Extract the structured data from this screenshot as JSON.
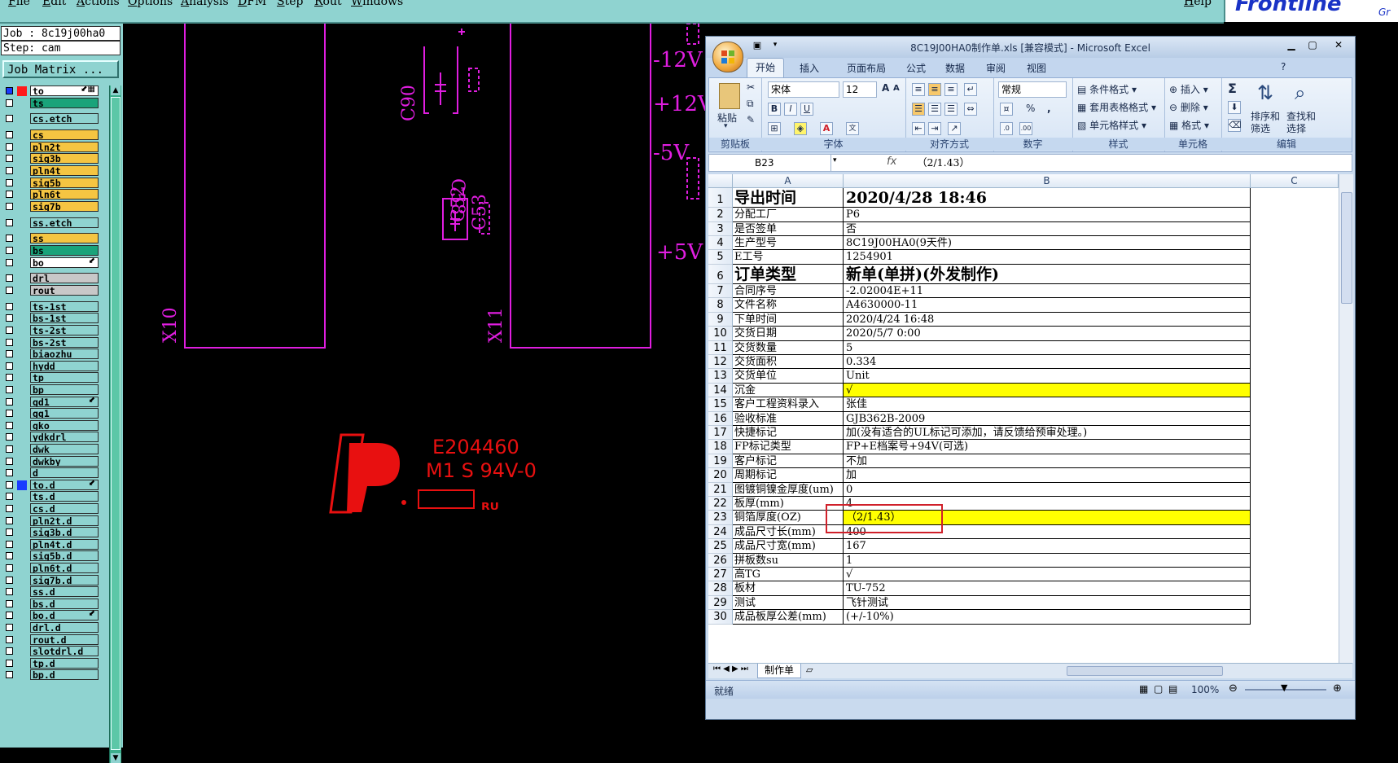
{
  "menu": [
    "File",
    "Edit",
    "Actions",
    "Options",
    "Analysis",
    "DFM",
    "Step",
    "Rout",
    "Windows"
  ],
  "help": "Help",
  "logo": {
    "brand": "Frontline",
    "suffix": "Gr"
  },
  "job": {
    "job_line": "Job : 8c19j00ha0",
    "step_line": "Step: cam",
    "matrix_button": "Job Matrix ..."
  },
  "layers": [
    {
      "name": "to",
      "color": "#ffffff",
      "swatch": "#ff1a1a",
      "mark": "⬋▦"
    },
    {
      "name": "ts",
      "color": "#1aa37a",
      "swatch": "",
      "mark": ""
    },
    {
      "name": "cs.etch",
      "color": "#8fd3d0",
      "swatch": "",
      "mark": ""
    },
    {
      "name": "cs",
      "color": "#f5c542",
      "swatch": "",
      "mark": ""
    },
    {
      "name": "pln2t",
      "color": "#f5c542",
      "swatch": "",
      "mark": ""
    },
    {
      "name": "sig3b",
      "color": "#f5c542",
      "swatch": "",
      "mark": ""
    },
    {
      "name": "pln4t",
      "color": "#f5c542",
      "swatch": "",
      "mark": ""
    },
    {
      "name": "sig5b",
      "color": "#f5c542",
      "swatch": "",
      "mark": ""
    },
    {
      "name": "pln6t",
      "color": "#f5c542",
      "swatch": "",
      "mark": ""
    },
    {
      "name": "sig7b",
      "color": "#f5c542",
      "swatch": "",
      "mark": ""
    },
    {
      "name": "ss.etch",
      "color": "#8fd3d0",
      "swatch": "",
      "mark": ""
    },
    {
      "name": "ss",
      "color": "#f5c542",
      "swatch": "",
      "mark": ""
    },
    {
      "name": "bs",
      "color": "#1aa37a",
      "swatch": "",
      "mark": ""
    },
    {
      "name": "bo",
      "color": "#ffffff",
      "swatch": "",
      "mark": "⬋"
    },
    {
      "name": "drl",
      "color": "#c8c8c8",
      "swatch": "",
      "mark": ""
    },
    {
      "name": "rout",
      "color": "#c8c8c8",
      "swatch": "",
      "mark": ""
    },
    {
      "name": "ts-1st",
      "color": "#8fd3d0",
      "swatch": "",
      "mark": ""
    },
    {
      "name": "bs-1st",
      "color": "#8fd3d0",
      "swatch": "",
      "mark": ""
    },
    {
      "name": "ts-2st",
      "color": "#8fd3d0",
      "swatch": "",
      "mark": ""
    },
    {
      "name": "bs-2st",
      "color": "#8fd3d0",
      "swatch": "",
      "mark": ""
    },
    {
      "name": "biaozhu",
      "color": "#8fd3d0",
      "swatch": "",
      "mark": ""
    },
    {
      "name": "hydd",
      "color": "#8fd3d0",
      "swatch": "",
      "mark": ""
    },
    {
      "name": "tp",
      "color": "#8fd3d0",
      "swatch": "",
      "mark": ""
    },
    {
      "name": "bp",
      "color": "#8fd3d0",
      "swatch": "",
      "mark": ""
    },
    {
      "name": "gd1",
      "color": "#8fd3d0",
      "swatch": "",
      "mark": "⬋"
    },
    {
      "name": "gg1",
      "color": "#8fd3d0",
      "swatch": "",
      "mark": ""
    },
    {
      "name": "gko",
      "color": "#8fd3d0",
      "swatch": "",
      "mark": ""
    },
    {
      "name": "ydkdrl",
      "color": "#8fd3d0",
      "swatch": "",
      "mark": ""
    },
    {
      "name": "dwk",
      "color": "#8fd3d0",
      "swatch": "",
      "mark": ""
    },
    {
      "name": "dwkby",
      "color": "#8fd3d0",
      "swatch": "",
      "mark": ""
    },
    {
      "name": "d",
      "color": "#8fd3d0",
      "swatch": "",
      "mark": ""
    },
    {
      "name": "to.d",
      "color": "#8fd3d0",
      "swatch": "#1a3cff",
      "mark": "⬋"
    },
    {
      "name": "ts.d",
      "color": "#8fd3d0",
      "swatch": "",
      "mark": ""
    },
    {
      "name": "cs.d",
      "color": "#8fd3d0",
      "swatch": "",
      "mark": ""
    },
    {
      "name": "pln2t.d",
      "color": "#8fd3d0",
      "swatch": "",
      "mark": ""
    },
    {
      "name": "sig3b.d",
      "color": "#8fd3d0",
      "swatch": "",
      "mark": ""
    },
    {
      "name": "pln4t.d",
      "color": "#8fd3d0",
      "swatch": "",
      "mark": ""
    },
    {
      "name": "sig5b.d",
      "color": "#8fd3d0",
      "swatch": "",
      "mark": ""
    },
    {
      "name": "pln6t.d",
      "color": "#8fd3d0",
      "swatch": "",
      "mark": ""
    },
    {
      "name": "sig7b.d",
      "color": "#8fd3d0",
      "swatch": "",
      "mark": ""
    },
    {
      "name": "ss.d",
      "color": "#8fd3d0",
      "swatch": "",
      "mark": ""
    },
    {
      "name": "bs.d",
      "color": "#8fd3d0",
      "swatch": "",
      "mark": ""
    },
    {
      "name": "bo.d",
      "color": "#8fd3d0",
      "swatch": "",
      "mark": "⬋"
    },
    {
      "name": "drl.d",
      "color": "#8fd3d0",
      "swatch": "",
      "mark": ""
    },
    {
      "name": "rout.d",
      "color": "#8fd3d0",
      "swatch": "",
      "mark": ""
    },
    {
      "name": "slotdrl.d",
      "color": "#8fd3d0",
      "swatch": "",
      "mark": ""
    },
    {
      "name": "tp.d",
      "color": "#8fd3d0",
      "swatch": "",
      "mark": ""
    },
    {
      "name": "bp.d",
      "color": "#8fd3d0",
      "swatch": "",
      "mark": ""
    }
  ],
  "cad": {
    "labels": {
      "x10": "X10",
      "x11": "X11",
      "c90": "C90",
      "c58": "C58",
      "c52": "C52",
      "c53": "C53",
      "v1": "-12V",
      "v2": "+12V",
      "v3": "-5V",
      "v4": "+5V"
    },
    "ul_code": "E204460",
    "ul_grade": "M1 S 94V-0",
    "ul_mark": "ᴿᵁ",
    "color": "#e01ee0",
    "ul_color": "#e81010"
  },
  "excel": {
    "title": "8C19J00HA0制作单.xls  [兼容模式] - Microsoft Excel",
    "tabs": [
      "开始",
      "插入",
      "页面布局",
      "公式",
      "数据",
      "审阅",
      "视图"
    ],
    "ribbon": {
      "paste": "粘贴",
      "clipboard": "剪贴板",
      "font_name": "宋体",
      "font_size": "12",
      "font_group": "字体",
      "align_group": "对齐方式",
      "number_format": "常规",
      "number_group": "数字",
      "cond_format": "条件格式",
      "table_format": "套用表格格式",
      "cell_style": "单元格样式",
      "style_group": "样式",
      "insert": "插入",
      "delete": "删除",
      "format": "格式",
      "cells_group": "单元格",
      "sort_filter": "排序和\n筛选",
      "find_select": "查找和\n选择",
      "edit_group": "编辑",
      "bold": "B",
      "italic": "I",
      "underline": "U",
      "percent": "%",
      "comma": ",",
      "sigma": "Σ"
    },
    "name_box": "B23",
    "fx": "fx",
    "formula": "（2/1.43）",
    "columns": [
      "A",
      "B",
      "C"
    ],
    "rows": [
      {
        "n": "1",
        "a": "导出时间",
        "b": "2020/4/28 18:46",
        "big": true,
        "hl": false
      },
      {
        "n": "2",
        "a": "分配工厂",
        "b": "P6",
        "big": false,
        "hl": false
      },
      {
        "n": "3",
        "a": "是否签单",
        "b": "否",
        "big": false,
        "hl": false
      },
      {
        "n": "4",
        "a": "生产型号",
        "b": "8C19J00HA0(9天件)",
        "big": false,
        "hl": false
      },
      {
        "n": "5",
        "a": "E工号",
        "b": "1254901",
        "big": false,
        "hl": false
      },
      {
        "n": "6",
        "a": "订单类型",
        "b": "新单(单拼)(外发制作)",
        "big": true,
        "hl": false
      },
      {
        "n": "7",
        "a": "合同序号",
        "b": "-2.02004E+11",
        "big": false,
        "hl": false
      },
      {
        "n": "8",
        "a": "文件名称",
        "b": "A4630000-11",
        "big": false,
        "hl": false
      },
      {
        "n": "9",
        "a": "下单时间",
        "b": "2020/4/24 16:48",
        "big": false,
        "hl": false
      },
      {
        "n": "10",
        "a": "交货日期",
        "b": "2020/5/7 0:00",
        "big": false,
        "hl": false
      },
      {
        "n": "11",
        "a": "交货数量",
        "b": "5",
        "big": false,
        "hl": false
      },
      {
        "n": "12",
        "a": "交货面积",
        "b": "0.334",
        "big": false,
        "hl": false
      },
      {
        "n": "13",
        "a": "交货单位",
        "b": "Unit",
        "big": false,
        "hl": false
      },
      {
        "n": "14",
        "a": "沉金",
        "b": "√",
        "big": false,
        "hl": true
      },
      {
        "n": "15",
        "a": "客户工程资料录入",
        "b": "张佳",
        "big": false,
        "hl": false
      },
      {
        "n": "16",
        "a": "验收标准",
        "b": "GJB362B-2009",
        "big": false,
        "hl": false
      },
      {
        "n": "17",
        "a": "快捷标记",
        "b": "加(没有适合的UL标记可添加，请反馈给预审处理。)",
        "big": false,
        "hl": false
      },
      {
        "n": "18",
        "a": "FP标记类型",
        "b": "FP+E档案号+94V(可选)",
        "big": false,
        "hl": false
      },
      {
        "n": "19",
        "a": "客户标记",
        "b": "不加",
        "big": false,
        "hl": false
      },
      {
        "n": "20",
        "a": "周期标记",
        "b": "加",
        "big": false,
        "hl": false
      },
      {
        "n": "21",
        "a": "图镀铜镍金厚度(um)",
        "b": "0",
        "big": false,
        "hl": false
      },
      {
        "n": "22",
        "a": "板厚(mm)",
        "b": "4",
        "big": false,
        "hl": false
      },
      {
        "n": "23",
        "a": "铜箔厚度(OZ)",
        "b": "（2/1.43）",
        "big": false,
        "hl": true
      },
      {
        "n": "24",
        "a": "成品尺寸长(mm)",
        "b": "400",
        "big": false,
        "hl": false
      },
      {
        "n": "25",
        "a": "成品尺寸宽(mm)",
        "b": "167",
        "big": false,
        "hl": false
      },
      {
        "n": "26",
        "a": "拼板数su",
        "b": "1",
        "big": false,
        "hl": false
      },
      {
        "n": "27",
        "a": "高TG",
        "b": "√",
        "big": false,
        "hl": false
      },
      {
        "n": "28",
        "a": "板材",
        "b": "TU-752",
        "big": false,
        "hl": false
      },
      {
        "n": "29",
        "a": "测试",
        "b": "飞针测试",
        "big": false,
        "hl": false
      },
      {
        "n": "30",
        "a": "成品板厚公差(mm)",
        "b": "(+/-10%)",
        "big": false,
        "hl": false
      }
    ],
    "sheet_tab": "制作单",
    "status": "就绪",
    "zoom": "100%",
    "highlight_color": "#ffff00",
    "select_color": "#d0202a"
  }
}
